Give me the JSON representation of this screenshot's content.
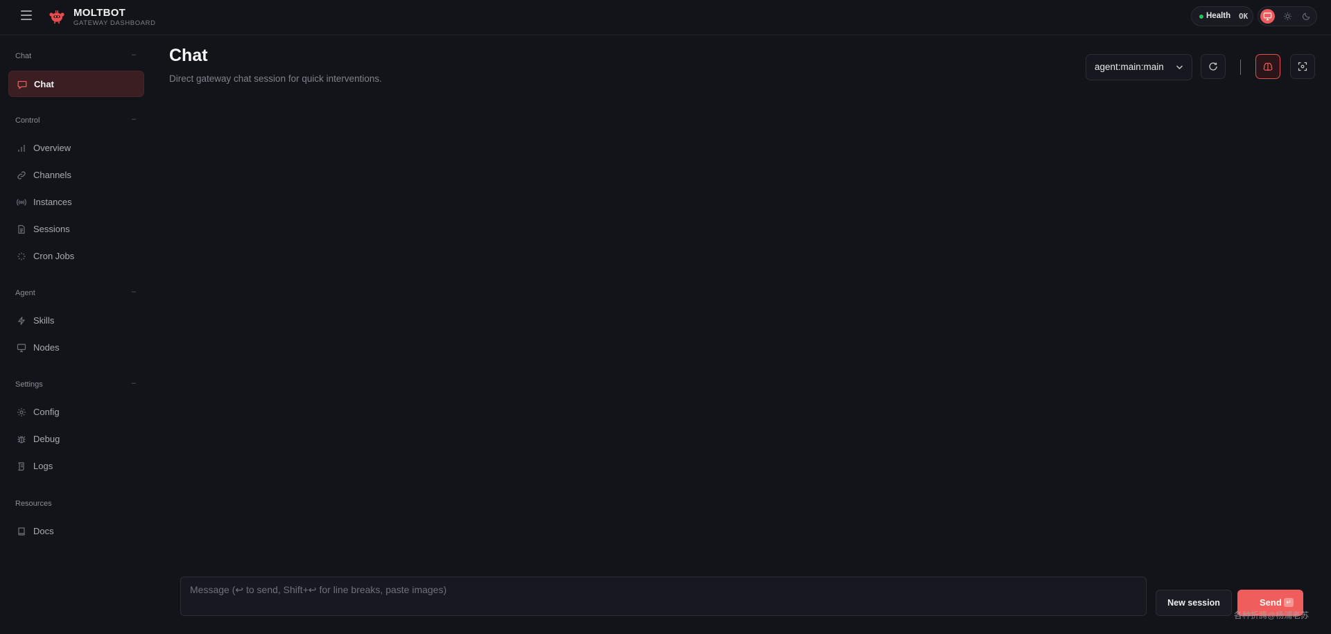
{
  "app": {
    "title": "MOLTBOT",
    "subtitle": "GATEWAY DASHBOARD",
    "accent_color": "#ef5a5a"
  },
  "header": {
    "health_label": "Health",
    "health_status": "OK",
    "health_color": "#22c55e",
    "theme_options": [
      "monitor-icon",
      "sun-icon",
      "moon-icon"
    ],
    "theme_selected": "monitor-icon"
  },
  "sidebar": {
    "sections": [
      {
        "title": "Chat",
        "collapse": "–",
        "items": [
          {
            "label": "Chat",
            "icon": "chat-bubble-icon",
            "active": true
          }
        ]
      },
      {
        "title": "Control",
        "collapse": "–",
        "items": [
          {
            "label": "Overview",
            "icon": "bar-chart-icon"
          },
          {
            "label": "Channels",
            "icon": "link-icon"
          },
          {
            "label": "Instances",
            "icon": "radio-icon"
          },
          {
            "label": "Sessions",
            "icon": "document-icon"
          },
          {
            "label": "Cron Jobs",
            "icon": "loader-icon"
          }
        ]
      },
      {
        "title": "Agent",
        "collapse": "–",
        "items": [
          {
            "label": "Skills",
            "icon": "bolt-icon"
          },
          {
            "label": "Nodes",
            "icon": "monitor-icon"
          }
        ]
      },
      {
        "title": "Settings",
        "collapse": "–",
        "items": [
          {
            "label": "Config",
            "icon": "gear-icon"
          },
          {
            "label": "Debug",
            "icon": "bug-icon"
          },
          {
            "label": "Logs",
            "icon": "scroll-icon"
          }
        ]
      },
      {
        "title": "Resources",
        "items": [
          {
            "label": "Docs",
            "icon": "book-icon"
          }
        ]
      }
    ]
  },
  "main": {
    "title": "Chat",
    "subtitle": "Direct gateway chat session for quick interventions.",
    "session_selected": "agent:main:main",
    "toolbar_icons": [
      "refresh-icon",
      "brain-icon",
      "focus-icon"
    ]
  },
  "composer": {
    "placeholder": "Message (↩ to send, Shift+↩ for line breaks, paste images)",
    "value": "",
    "new_session_label": "New session",
    "send_label": "Send",
    "send_key": "↵"
  },
  "watermark": "各种折腾@杨浦老苏"
}
